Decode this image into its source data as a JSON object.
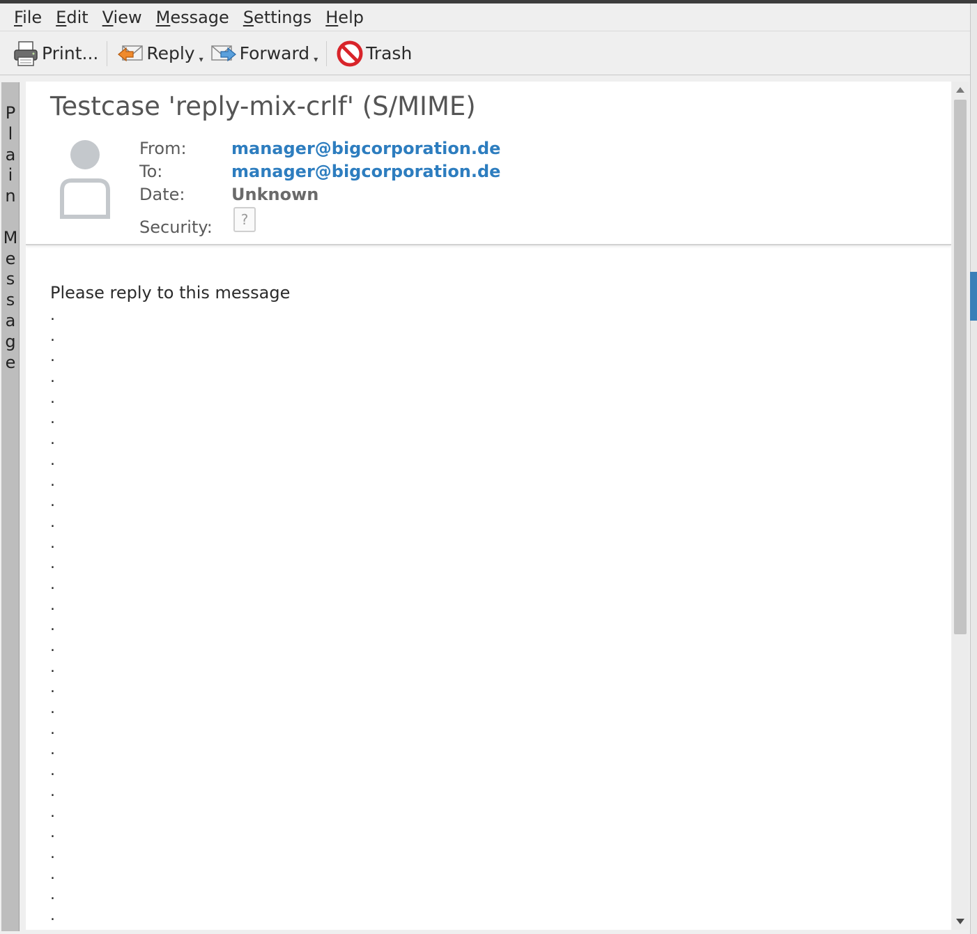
{
  "menubar": {
    "items": [
      {
        "mnemonic": "F",
        "rest": "ile"
      },
      {
        "mnemonic": "E",
        "rest": "dit"
      },
      {
        "mnemonic": "V",
        "rest": "iew"
      },
      {
        "mnemonic": "M",
        "rest": "essage"
      },
      {
        "mnemonic": "S",
        "rest": "ettings"
      },
      {
        "mnemonic": "H",
        "rest": "elp"
      }
    ]
  },
  "toolbar": {
    "print_label": "Print...",
    "reply_label": "Reply",
    "forward_label": "Forward",
    "trash_label": "Trash",
    "dropdown_glyph": "▾"
  },
  "sidetab": {
    "letters": [
      "P",
      "l",
      "a",
      "i",
      "n",
      " ",
      "M",
      "e",
      "s",
      "s",
      "a",
      "g",
      "e"
    ]
  },
  "message": {
    "subject": "Testcase 'reply-mix-crlf' (S/MIME)",
    "from_label": "From:",
    "from_value": "manager@bigcorporation.de",
    "to_label": "To:",
    "to_value": "manager@bigcorporation.de",
    "date_label": "Date:",
    "date_value": "Unknown",
    "security_label": "Security:",
    "security_icon_glyph": "?",
    "body_first_line": "Please reply to this message",
    "body_dot_lines": [
      ".",
      ".",
      ".",
      ".",
      ".",
      ".",
      ".",
      ".",
      ".",
      ".",
      ".",
      ".",
      ".",
      ".",
      ".",
      ".",
      ".",
      ".",
      ".",
      ".",
      ".",
      ".",
      ".",
      ".",
      ".",
      ".",
      ".",
      ".",
      ".",
      "."
    ]
  },
  "icons": {
    "print": "printer-icon",
    "reply": "reply-icon",
    "forward": "forward-icon",
    "trash": "trash-icon",
    "avatar": "contact-avatar-icon",
    "security": "security-unknown-icon"
  },
  "colors": {
    "link": "#2d7dbf",
    "trash_red": "#d8242a",
    "accent": "#3a7fb8"
  }
}
